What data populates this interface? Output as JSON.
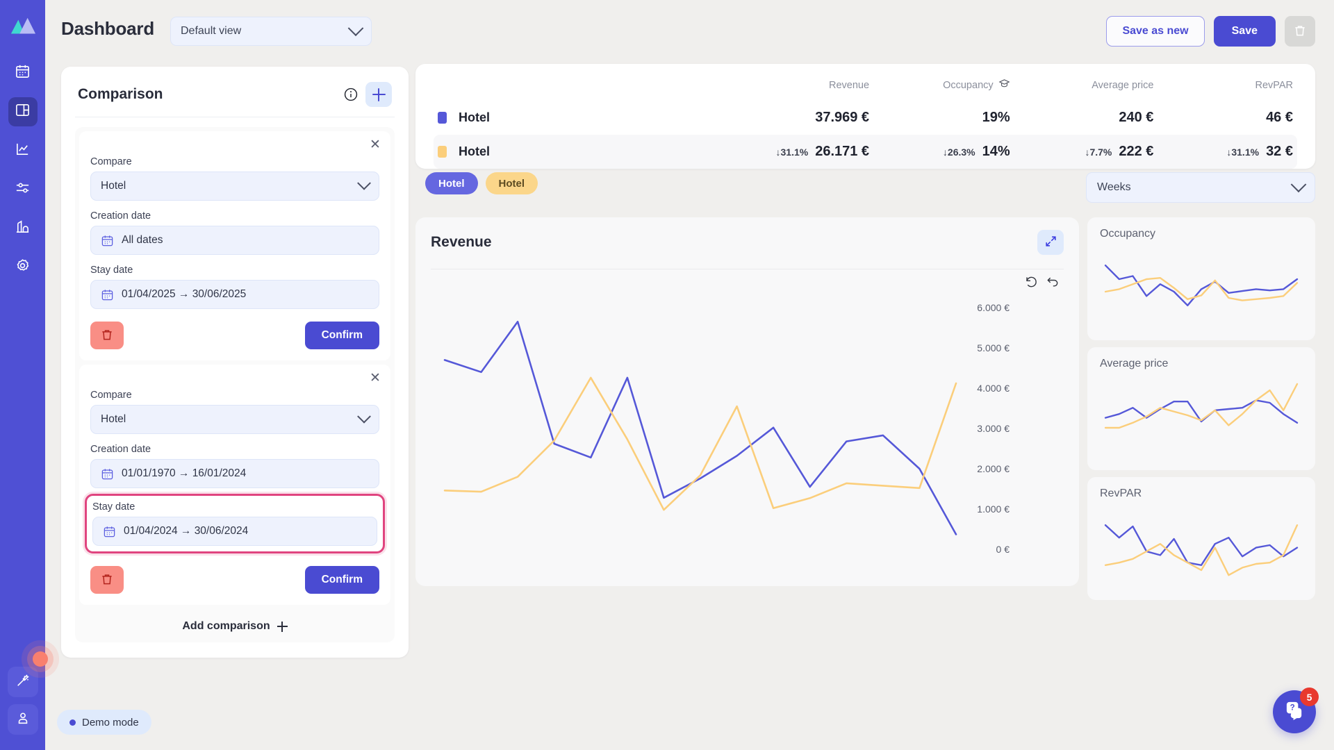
{
  "app": {
    "logo_icon": "mountain-logo-icon",
    "nav": [
      {
        "icon": "calendar-icon",
        "name": "calendar",
        "active": false
      },
      {
        "icon": "dashboard-panel-icon",
        "name": "dashboard",
        "active": true
      },
      {
        "icon": "line-chart-icon",
        "name": "analytics",
        "active": false
      },
      {
        "icon": "sliders-icon",
        "name": "settings-sliders",
        "active": false
      },
      {
        "icon": "bar-chart-icon",
        "name": "reports",
        "active": false
      },
      {
        "icon": "gear-icon",
        "name": "configuration",
        "active": false
      }
    ],
    "bottom_nav": [
      {
        "icon": "magic-wand-icon",
        "name": "assistant"
      },
      {
        "icon": "user-icon",
        "name": "account"
      }
    ]
  },
  "header": {
    "title": "Dashboard",
    "view_select": {
      "value": "Default view",
      "icon": "chevron-down-icon"
    },
    "save_as_new_label": "Save as new",
    "save_label": "Save",
    "delete_icon": "trash-icon"
  },
  "comparison": {
    "title": "Comparison",
    "info_icon": "info-icon",
    "add_icon": "plus-icon",
    "add_comparison_label": "Add comparison",
    "cards": [
      {
        "close_icon": "close-icon",
        "compare_label": "Compare",
        "compare_value": "Hotel",
        "creation_date_label": "Creation date",
        "creation_date_value": "All dates",
        "stay_date_label": "Stay date",
        "stay_date_value": "01/04/2025 → 30/06/2025",
        "delete_icon": "trash-icon",
        "confirm_label": "Confirm",
        "highlighted": false
      },
      {
        "close_icon": "close-icon",
        "compare_label": "Compare",
        "compare_value": "Hotel",
        "creation_date_label": "Creation date",
        "creation_date_value": "01/01/1970 → 16/01/2024",
        "stay_date_label": "Stay date",
        "stay_date_value": "01/04/2024 → 30/06/2024",
        "delete_icon": "trash-icon",
        "confirm_label": "Confirm",
        "highlighted": true
      }
    ]
  },
  "kpi": {
    "columns": [
      "",
      "Revenue",
      "Occupancy",
      "Average price",
      "RevPAR"
    ],
    "occupancy_icon": "graduation-cap-icon",
    "rows": [
      {
        "name": "Hotel",
        "color": "#5558d8",
        "revenue": "37.969 €",
        "occupancy": "19%",
        "average_price": "240 €",
        "revpar": "46 €",
        "revenue_delta": "",
        "occupancy_delta": "",
        "average_price_delta": "",
        "revpar_delta": ""
      },
      {
        "name": "Hotel",
        "color": "#fbce7b",
        "revenue": "26.171 €",
        "occupancy": "14%",
        "average_price": "222 €",
        "revpar": "32 €",
        "revenue_delta": "↓31.1%",
        "occupancy_delta": "↓26.3%",
        "average_price_delta": "↓7.7%",
        "revpar_delta": "↓31.1%"
      }
    ]
  },
  "chart_section": {
    "pills": [
      {
        "label": "Hotel",
        "style": "blue"
      },
      {
        "label": "Hotel",
        "style": "yellow"
      }
    ],
    "period_select": {
      "value": "Weeks",
      "icon": "chevron-down-icon"
    },
    "expand_icon": "expand-arrows-icon",
    "reset_zoom_icon": "reset-zoom-icon",
    "undo_icon": "undo-arrow-icon"
  },
  "chart_data": [
    {
      "type": "line",
      "title": "Revenue",
      "xlabel": "",
      "ylabel": "",
      "ylim": [
        0,
        6000
      ],
      "yticks": [
        0,
        1000,
        2000,
        3000,
        4000,
        5000,
        6000
      ],
      "ytick_labels": [
        "0 €",
        "1.000 €",
        "2.000 €",
        "3.000 €",
        "4.000 €",
        "5.000 €",
        "6.000 €"
      ],
      "grid": false,
      "legend": "none",
      "series": [
        {
          "name": "Hotel",
          "color": "#5558d8",
          "values": [
            4700,
            4400,
            5650,
            2620,
            2280,
            4260,
            1280,
            1760,
            2320,
            3020,
            1550,
            2680,
            2830,
            2000,
            370
          ]
        },
        {
          "name": "Hotel",
          "color": "#fbce7b",
          "values": [
            1460,
            1430,
            1800,
            2700,
            4260,
            2730,
            980,
            1840,
            3550,
            1020,
            1270,
            1640,
            1580,
            1520,
            4120
          ]
        }
      ]
    },
    {
      "type": "line",
      "title": "Occupancy",
      "ylim": [
        0,
        1
      ],
      "grid": false,
      "legend": "none",
      "series": [
        {
          "name": "Hotel",
          "color": "#5558d8",
          "values": [
            0.82,
            0.6,
            0.65,
            0.33,
            0.52,
            0.4,
            0.18,
            0.44,
            0.56,
            0.38,
            0.41,
            0.44,
            0.42,
            0.44,
            0.6
          ]
        },
        {
          "name": "Hotel",
          "color": "#fbce7b",
          "values": [
            0.4,
            0.44,
            0.52,
            0.6,
            0.62,
            0.46,
            0.28,
            0.34,
            0.58,
            0.3,
            0.26,
            0.28,
            0.3,
            0.33,
            0.54
          ]
        }
      ]
    },
    {
      "type": "line",
      "title": "Average price",
      "ylim": [
        0,
        1
      ],
      "grid": false,
      "legend": "none",
      "series": [
        {
          "name": "Hotel",
          "color": "#5558d8",
          "values": [
            0.46,
            0.52,
            0.62,
            0.46,
            0.6,
            0.72,
            0.72,
            0.4,
            0.58,
            0.6,
            0.62,
            0.74,
            0.7,
            0.52,
            0.38
          ]
        },
        {
          "name": "Hotel",
          "color": "#fbce7b",
          "values": [
            0.3,
            0.3,
            0.38,
            0.48,
            0.62,
            0.56,
            0.5,
            0.42,
            0.58,
            0.34,
            0.52,
            0.74,
            0.9,
            0.58,
            1.0
          ]
        }
      ]
    },
    {
      "type": "line",
      "title": "RevPAR",
      "ylim": [
        0,
        1
      ],
      "grid": false,
      "legend": "none",
      "series": [
        {
          "name": "Hotel",
          "color": "#5558d8",
          "values": [
            0.82,
            0.62,
            0.8,
            0.4,
            0.34,
            0.6,
            0.22,
            0.18,
            0.52,
            0.62,
            0.32,
            0.46,
            0.5,
            0.32,
            0.46
          ]
        },
        {
          "name": "Hotel",
          "color": "#fbce7b",
          "values": [
            0.18,
            0.22,
            0.28,
            0.4,
            0.52,
            0.34,
            0.22,
            0.1,
            0.46,
            0.02,
            0.14,
            0.2,
            0.22,
            0.34,
            0.82
          ]
        }
      ]
    }
  ],
  "footer": {
    "demo_mode_label": "Demo mode",
    "chat_icon": "help-chat-icon",
    "chat_badge": "5"
  }
}
